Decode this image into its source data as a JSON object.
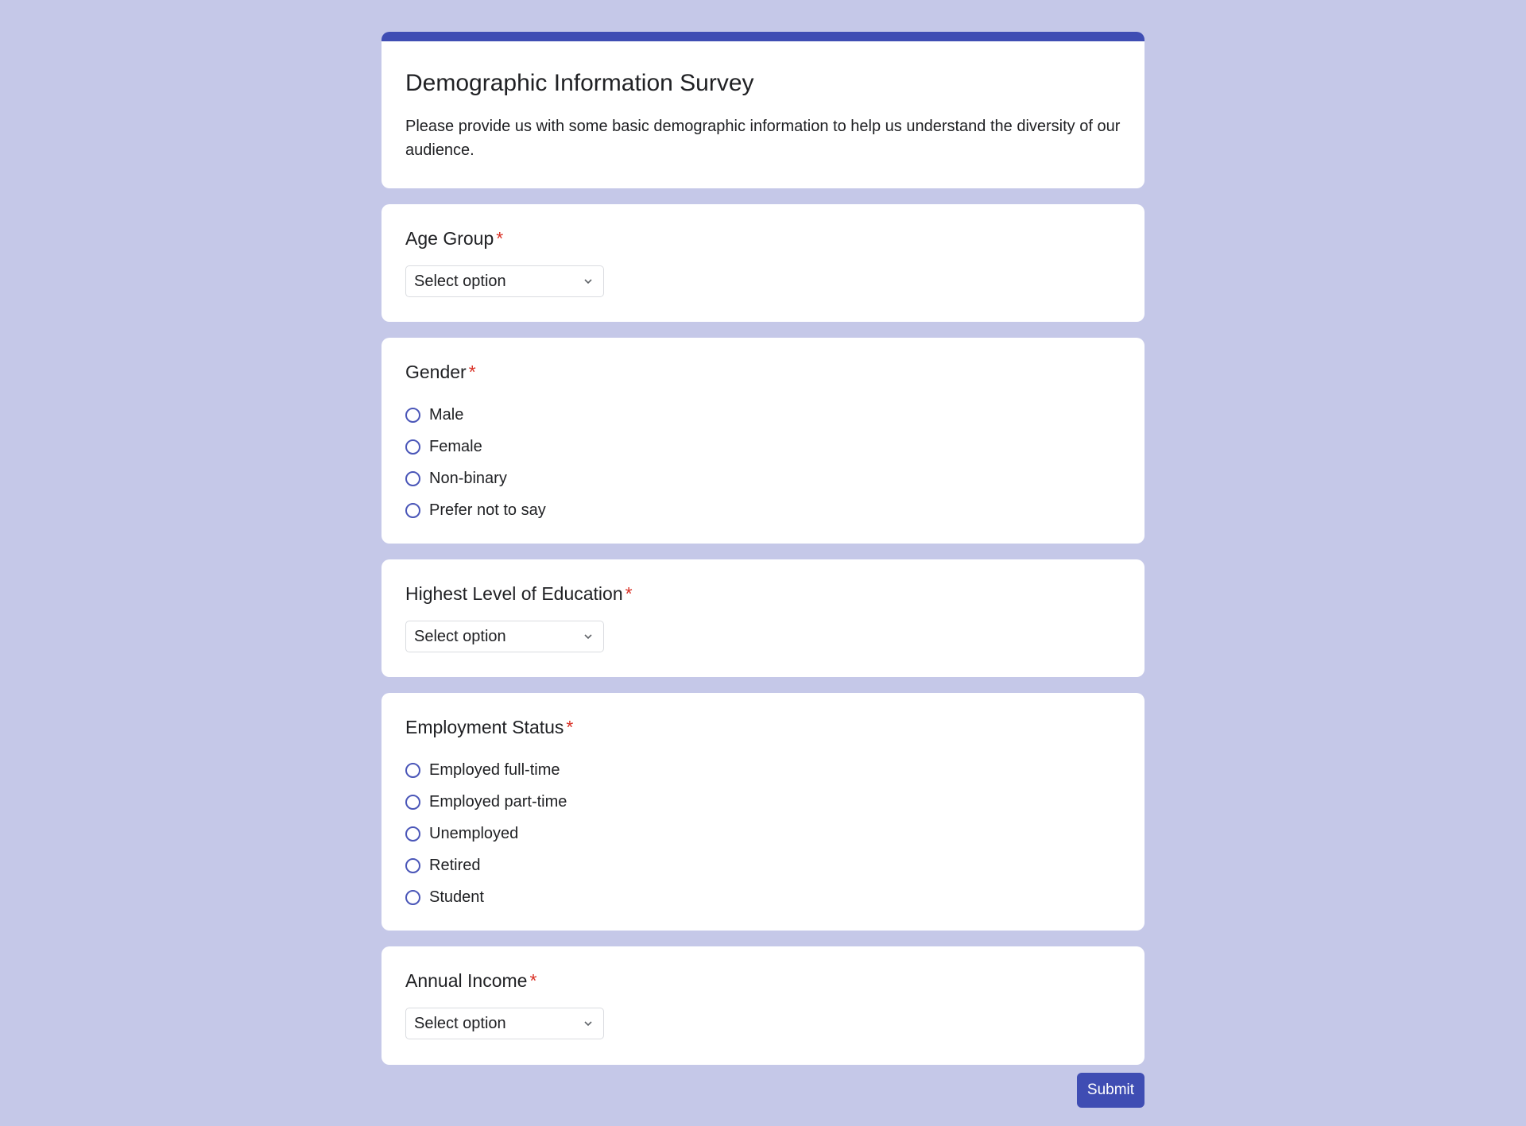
{
  "header": {
    "title": "Demographic Information Survey",
    "description": "Please provide us with some basic demographic information to help us understand the diversity of our audience."
  },
  "questions": {
    "age": {
      "label": "Age Group",
      "required_mark": "*",
      "select_value": "Select option"
    },
    "gender": {
      "label": "Gender",
      "required_mark": "*",
      "options": [
        "Male",
        "Female",
        "Non-binary",
        "Prefer not to say"
      ]
    },
    "education": {
      "label": "Highest Level of Education",
      "required_mark": "*",
      "select_value": "Select option"
    },
    "employment": {
      "label": "Employment Status",
      "required_mark": "*",
      "options": [
        "Employed full-time",
        "Employed part-time",
        "Unemployed",
        "Retired",
        "Student"
      ]
    },
    "income": {
      "label": "Annual Income",
      "required_mark": "*",
      "select_value": "Select option"
    }
  },
  "submit_label": "Submit",
  "colors": {
    "background": "#c5c8e8",
    "accent": "#3f4db3",
    "required": "#d93025"
  },
  "icons": {
    "select_chevron": "chevron-down-icon",
    "radio": "radio-unchecked-icon"
  }
}
